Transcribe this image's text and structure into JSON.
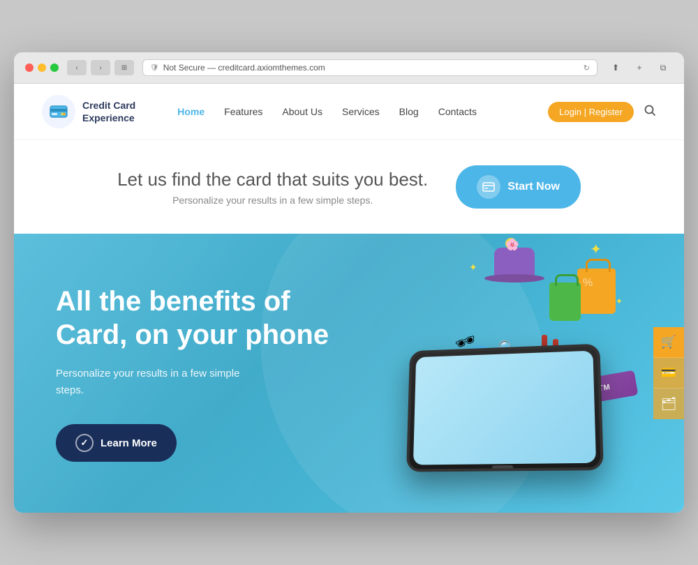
{
  "browser": {
    "url": "Not Secure — creditcard.axiomthemes.com",
    "reload_label": "↻"
  },
  "nav": {
    "logo_text": "Credit Card\nExperience",
    "links": [
      {
        "label": "Home",
        "active": true
      },
      {
        "label": "Features",
        "active": false
      },
      {
        "label": "About Us",
        "active": false
      },
      {
        "label": "Services",
        "active": false
      },
      {
        "label": "Blog",
        "active": false
      },
      {
        "label": "Contacts",
        "active": false
      }
    ],
    "auth_button": "Login  |  Register",
    "search_placeholder": "Search..."
  },
  "hero_top": {
    "title": "Let us find the card that suits you best.",
    "subtitle": "Personalize your results in a few simple steps.",
    "cta_button": "Start Now"
  },
  "hero_main": {
    "title": "All the benefits of Card, on your phone",
    "subtitle": "Personalize your results in a few simple steps.",
    "cta_button": "Learn More",
    "atm_label": "ATM"
  },
  "sidebar_tabs": [
    {
      "icon": "🛒"
    },
    {
      "icon": "💳"
    },
    {
      "icon": "🗂"
    }
  ],
  "colors": {
    "accent_blue": "#4db6e8",
    "accent_orange": "#f5a623",
    "dark_navy": "#1a2e5a",
    "hero_bg": "#4ab8d8"
  }
}
